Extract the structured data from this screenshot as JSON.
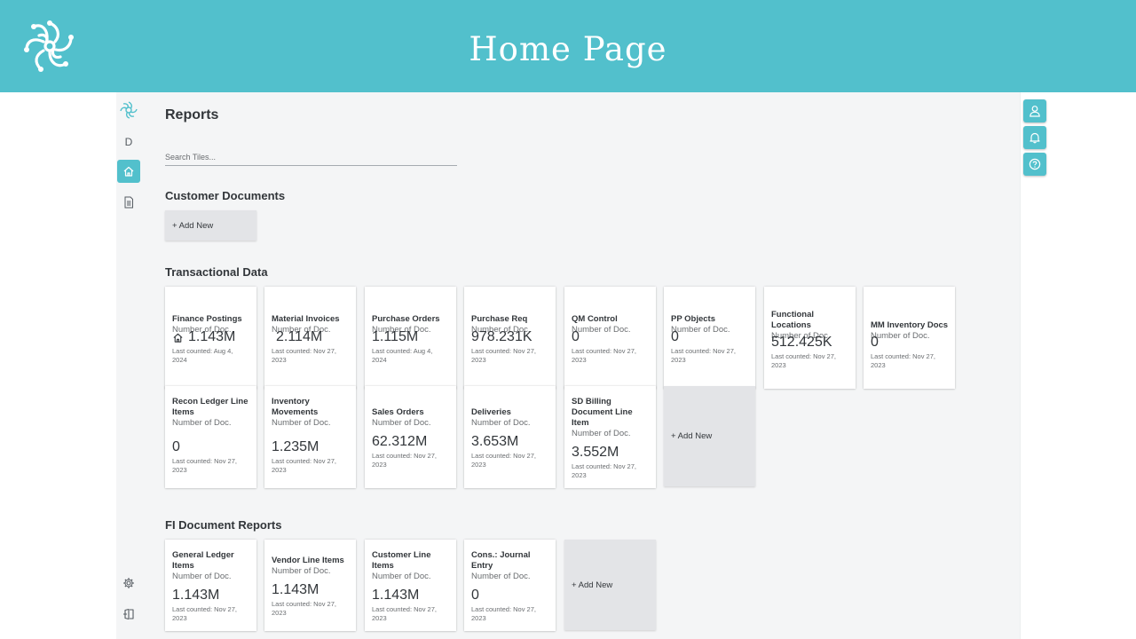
{
  "banner": {
    "title": "Home Page"
  },
  "left_nav": {
    "letter": "D"
  },
  "reports": {
    "title": "Reports",
    "search_placeholder": "Search Tiles..."
  },
  "sections": {
    "customer": {
      "title": "Customer Documents",
      "add_label": "+ Add New"
    },
    "transactional": {
      "title": "Transactional Data",
      "add_label": "+ Add New",
      "tiles": [
        {
          "title": "Finance Postings",
          "subtitle": "Number of Doc.",
          "value": "1.143M",
          "footer": "Last counted: Aug 4, 2024",
          "icon": "home-icon"
        },
        {
          "title": "Material Invoices",
          "subtitle": "Number of Doc.",
          "value": "2.114M",
          "footer": "Last counted: Nov 27, 2023"
        },
        {
          "title": "Purchase Orders",
          "subtitle": "Number of Doc.",
          "value": "1.115M",
          "footer": "Last counted: Aug 4, 2024"
        },
        {
          "title": "Purchase Req",
          "subtitle": "Number of Doc.",
          "value": "978.231K",
          "footer": "Last counted: Nov 27, 2023"
        },
        {
          "title": "QM Control",
          "subtitle": "Number of Doc.",
          "value": "0",
          "footer": "Last counted: Nov 27, 2023"
        },
        {
          "title": "PP Objects",
          "subtitle": "Number of Doc.",
          "value": "0",
          "footer": "Last counted: Nov 27, 2023"
        },
        {
          "title": "Functional Locations",
          "subtitle": "Number of Doc.",
          "value": "512.425K",
          "footer": "Last counted: Nov 27, 2023"
        },
        {
          "title": "MM Inventory Docs",
          "subtitle": "Number of Doc.",
          "value": "0",
          "footer": "Last counted: Nov 27, 2023"
        },
        {
          "title": "Recon Ledger Line Items",
          "subtitle": "Number of Doc.",
          "value": "0",
          "footer": "Last counted: Nov 27, 2023"
        },
        {
          "title": "Inventory Movements",
          "subtitle": "Number of Doc.",
          "value": "1.235M",
          "footer": "Last counted: Nov 27, 2023"
        },
        {
          "title": "Sales Orders",
          "subtitle": "Number of Doc.",
          "value": "62.312M",
          "footer": "Last counted: Nov 27, 2023"
        },
        {
          "title": "Deliveries",
          "subtitle": "Number of Doc.",
          "value": "3.653M",
          "footer": "Last counted: Nov 27, 2023"
        },
        {
          "title": "SD Billing Document Line Item",
          "subtitle": "Number of Doc.",
          "value": "3.552M",
          "footer": "Last counted: Nov 27, 2023"
        }
      ]
    },
    "fi": {
      "title": "FI Document Reports",
      "add_label": "+ Add New",
      "tiles": [
        {
          "title": "General Ledger Items",
          "subtitle": "Number of Doc.",
          "value": "1.143M",
          "footer": "Last counted: Nov 27, 2023"
        },
        {
          "title": "Vendor Line Items",
          "subtitle": "Number of Doc.",
          "value": "1.143M",
          "footer": "Last counted: Nov 27, 2023"
        },
        {
          "title": "Customer Line Items",
          "subtitle": "Number of Doc.",
          "value": "1.143M",
          "footer": "Last counted: Nov 27, 2023"
        },
        {
          "title": "Cons.: Journal Entry",
          "subtitle": "Number of Doc.",
          "value": "0",
          "footer": "Last counted: Nov 27, 2023"
        }
      ]
    }
  },
  "colors": {
    "accent": "#52c0cc",
    "background": "#f4f5f6",
    "add_tile": "#e3e4e7"
  }
}
